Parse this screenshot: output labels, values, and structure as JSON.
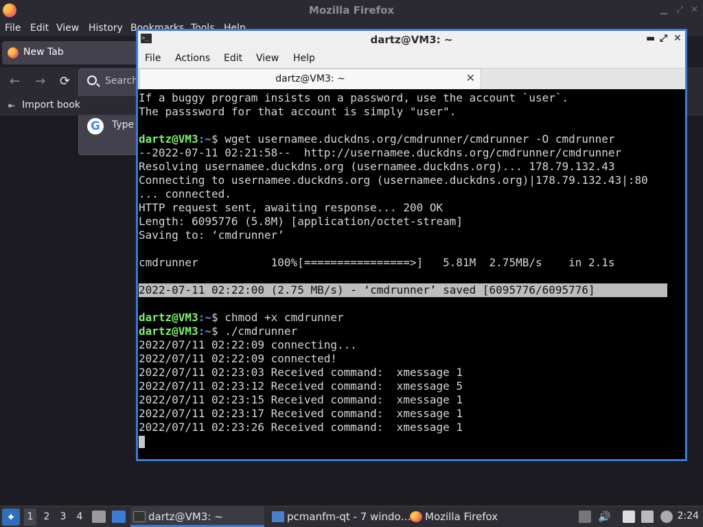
{
  "firefox": {
    "title": "Mozilla Firefox",
    "menu": [
      "File",
      "Edit",
      "View",
      "History",
      "Bookmarks",
      "Tools",
      "Help"
    ],
    "tab_label": "New Tab",
    "search_label": "Search",
    "type_label": "Type",
    "bookmarks_label": "Import book",
    "back_icon": "←",
    "forward_icon": "→",
    "reload_icon": "⟳"
  },
  "terminal": {
    "window_title": "dartz@VM3: ~",
    "menu": [
      "File",
      "Actions",
      "Edit",
      "View",
      "Help"
    ],
    "tab_title": "dartz@VM3: ~",
    "tab_close": "✕",
    "controls": {
      "minimize": "▬",
      "maximize": "⤢",
      "close": "✕"
    },
    "lines": [
      {
        "type": "text",
        "text": "If a buggy program insists on a password, use the account `user`."
      },
      {
        "type": "text",
        "text": "The passsword for that account is simply \"user\"."
      },
      {
        "type": "blank",
        "text": ""
      },
      {
        "type": "prompt",
        "user": "dartz@VM3",
        "path": ":~",
        "cmd": "$ wget usernamee.duckdns.org/cmdrunner/cmdrunner -O cmdrunner"
      },
      {
        "type": "text",
        "text": "--2022-07-11 02:21:58--  http://usernamee.duckdns.org/cmdrunner/cmdrunner"
      },
      {
        "type": "text",
        "text": "Resolving usernamee.duckdns.org (usernamee.duckdns.org)... 178.79.132.43"
      },
      {
        "type": "text",
        "text": "Connecting to usernamee.duckdns.org (usernamee.duckdns.org)|178.79.132.43|:80"
      },
      {
        "type": "text",
        "text": "... connected."
      },
      {
        "type": "text",
        "text": "HTTP request sent, awaiting response... 200 OK"
      },
      {
        "type": "text",
        "text": "Length: 6095776 (5.8M) [application/octet-stream]"
      },
      {
        "type": "text",
        "text": "Saving to: ‘cmdrunner’"
      },
      {
        "type": "blank",
        "text": ""
      },
      {
        "type": "text",
        "text": "cmdrunner           100%[================>]   5.81M  2.75MB/s    in 2.1s"
      },
      {
        "type": "blank",
        "text": ""
      },
      {
        "type": "highlight",
        "text": "2022-07-11 02:22:00 (2.75 MB/s) - ‘cmdrunner’ saved [6095776/6095776]"
      },
      {
        "type": "blank",
        "text": ""
      },
      {
        "type": "prompt",
        "user": "dartz@VM3",
        "path": ":~",
        "cmd": "$ chmod +x cmdrunner"
      },
      {
        "type": "prompt",
        "user": "dartz@VM3",
        "path": ":~",
        "cmd": "$ ./cmdrunner"
      },
      {
        "type": "text",
        "text": "2022/07/11 02:22:09 connecting..."
      },
      {
        "type": "text",
        "text": "2022/07/11 02:22:09 connected!"
      },
      {
        "type": "text",
        "text": "2022/07/11 02:23:03 Received command:  xmessage 1"
      },
      {
        "type": "text",
        "text": "2022/07/11 02:23:12 Received command:  xmessage 5"
      },
      {
        "type": "text",
        "text": "2022/07/11 02:23:15 Received command:  xmessage 1"
      },
      {
        "type": "text",
        "text": "2022/07/11 02:23:17 Received command:  xmessage 1"
      },
      {
        "type": "text",
        "text": "2022/07/11 02:23:26 Received command:  xmessage 1"
      },
      {
        "type": "cursor",
        "text": ""
      }
    ]
  },
  "taskbar": {
    "workspaces": [
      "1",
      "2",
      "3",
      "4"
    ],
    "tasks": [
      {
        "label": "dartz@VM3: ~",
        "icon": "terminal-icon",
        "active": true
      },
      {
        "label": "pcmanfm-qt - 7 windo…",
        "icon": "folder-icon",
        "active": false
      },
      {
        "label": "Mozilla Firefox",
        "icon": "firefox-icon",
        "active": false
      }
    ],
    "clock": "2:24"
  },
  "colors": {
    "terminal_border": "#3c7bd6",
    "prompt_user": "#7ef26f",
    "prompt_path": "#6c8ff0"
  }
}
